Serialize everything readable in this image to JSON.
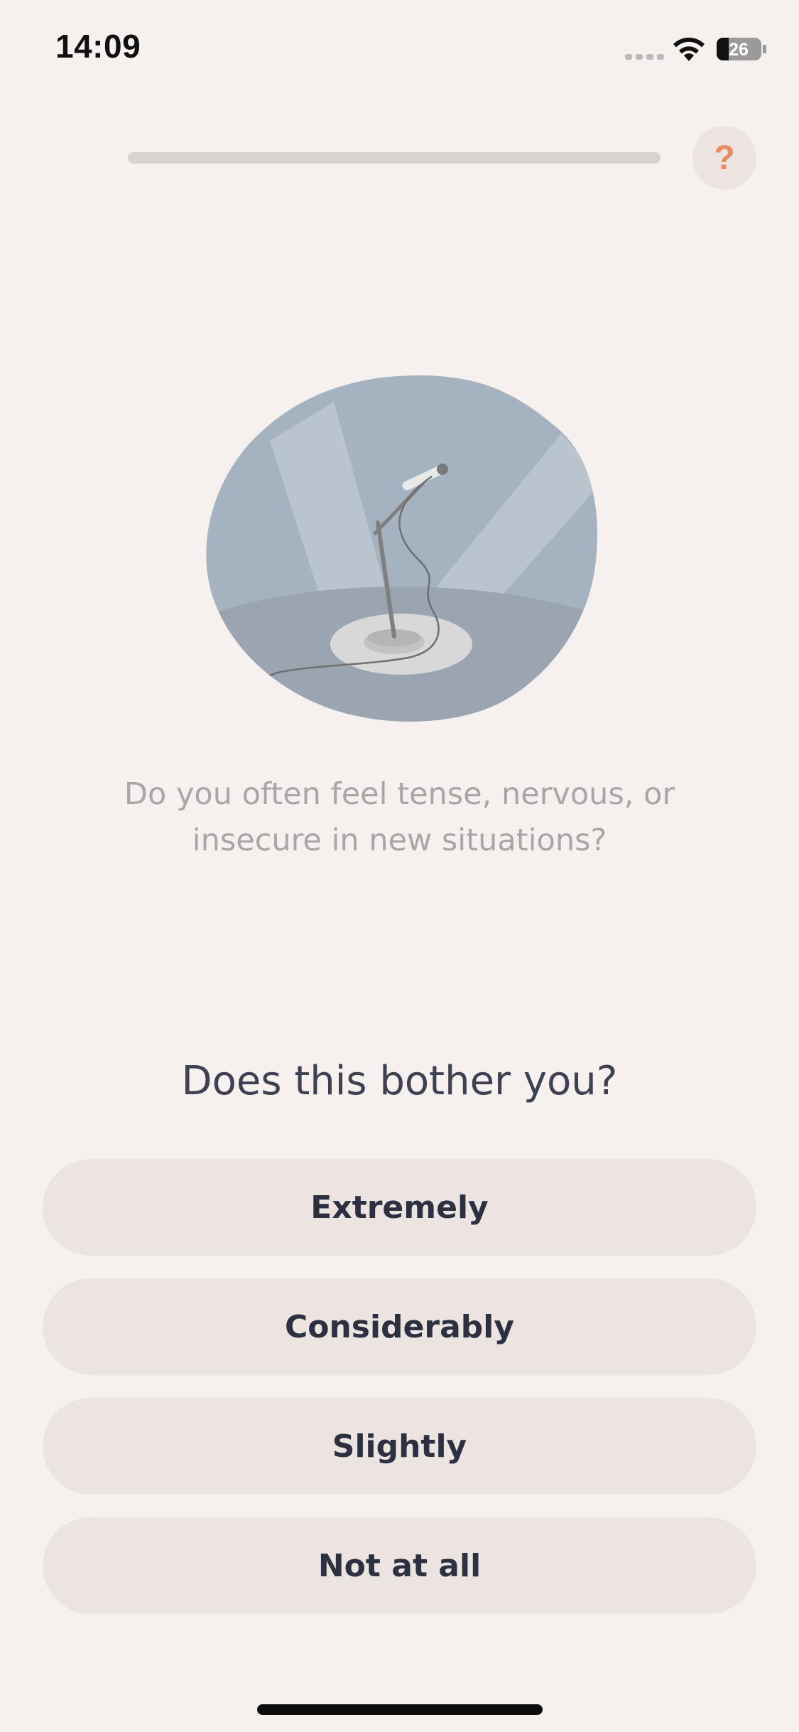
{
  "status_bar": {
    "time": "14:09",
    "battery_level": "26",
    "icons": [
      "cellular-signal-icon",
      "wifi-icon",
      "battery-icon"
    ]
  },
  "progress": {
    "value": 0.0
  },
  "help": {
    "label": "?"
  },
  "illustration": {
    "icon": "microphone-spotlight-illustration"
  },
  "question": {
    "text": "Do you often feel tense, nervous, or insecure in new situations?"
  },
  "prompt": {
    "text": "Does this bother you?"
  },
  "answers": [
    {
      "label": "Extremely"
    },
    {
      "label": "Considerably"
    },
    {
      "label": "Slightly"
    },
    {
      "label": "Not at all"
    }
  ],
  "colors": {
    "background": "#f6f1ee",
    "button": "#ebe4e0",
    "accent": "#ea8b62",
    "text_dark": "#2c3040",
    "text_muted": "#a8a6a7"
  }
}
